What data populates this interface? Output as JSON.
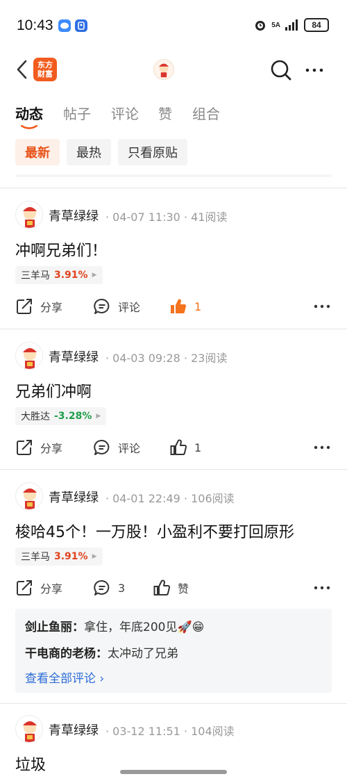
{
  "status_bar": {
    "time": "10:43",
    "network": "5A",
    "battery": "84"
  },
  "nav": {
    "logo_line1": "东方",
    "logo_line2": "财富"
  },
  "tabs": [
    "动态",
    "帖子",
    "评论",
    "赞",
    "组合"
  ],
  "filters": [
    "最新",
    "最热",
    "只看原贴"
  ],
  "posts": [
    {
      "author": "青草绿绿",
      "meta": "· 04-07 11:30 · 41阅读",
      "text": "冲啊兄弟们！",
      "stock_name": "三羊马",
      "stock_change": "3.91%",
      "share": "分享",
      "comment": "评论",
      "like": "1"
    },
    {
      "author": "青草绿绿",
      "meta": "· 04-03 09:28 · 23阅读",
      "text": "兄弟们冲啊",
      "stock_name": "大胜达",
      "stock_change": "-3.28%",
      "share": "分享",
      "comment": "评论",
      "like": "1"
    },
    {
      "author": "青草绿绿",
      "meta": "· 04-01 22:49 · 106阅读",
      "text": "梭哈45个！一万股！小盈利不要打回原形",
      "stock_name": "三羊马",
      "stock_change": "3.91%",
      "share": "分享",
      "comment": "3",
      "like": "赞",
      "comments": [
        {
          "user": "剑止鱼丽：",
          "text": "拿住，年底200见🚀😁"
        },
        {
          "user": "干电商的老杨：",
          "text": "太冲动了兄弟"
        }
      ],
      "view_all": "查看全部评论 ›"
    },
    {
      "author": "青草绿绿",
      "meta": "· 03-12 11:51 · 104阅读",
      "text": "垃圾"
    }
  ],
  "colors": {
    "accent": "#e8541a",
    "stock_up": "#e0431f",
    "stock_down": "#1f9e4a",
    "like_active": "#f5731e",
    "link": "#2b6cd8"
  }
}
